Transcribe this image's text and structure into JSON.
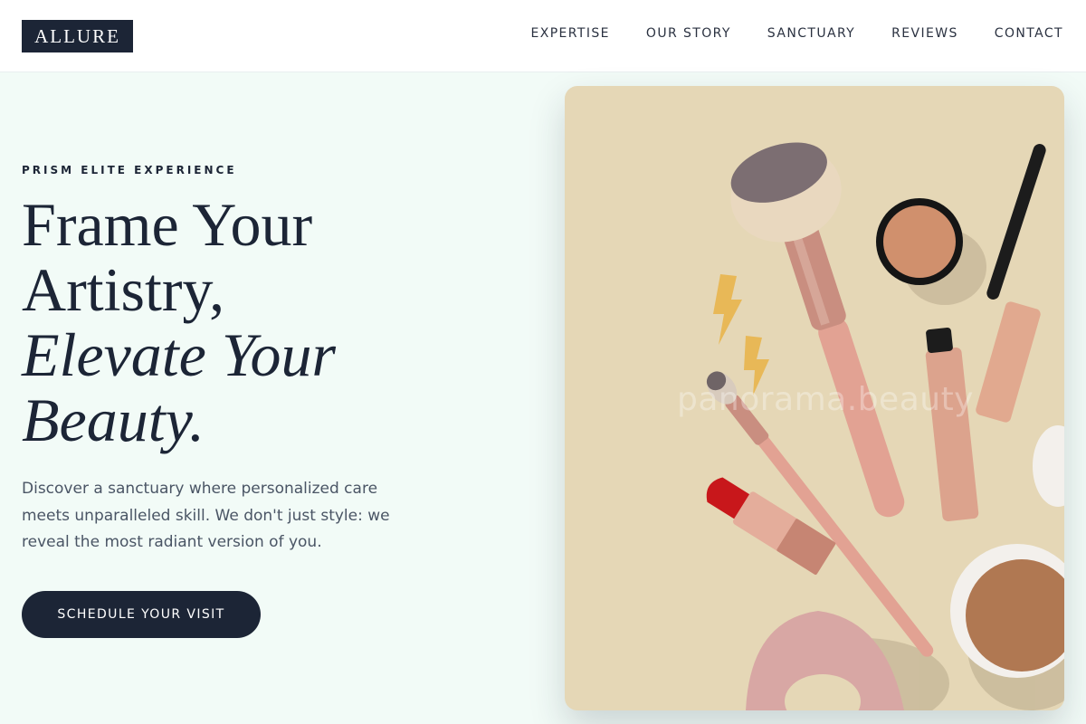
{
  "header": {
    "logo": "ALLURE",
    "nav": [
      "EXPERTISE",
      "OUR STORY",
      "SANCTUARY",
      "REVIEWS",
      "CONTACT"
    ]
  },
  "hero": {
    "eyebrow": "PRISM ELITE EXPERIENCE",
    "headline_line1": "Frame Your",
    "headline_line2": "Artistry,",
    "headline_line3": "Elevate Your",
    "headline_line4": "Beauty.",
    "description": "Discover a sanctuary where personalized care meets unparalleled skill. We don't just style: we reveal the most radiant version of you.",
    "cta": "SCHEDULE YOUR VISIT"
  },
  "image": {
    "watermark": "panorama.beauty"
  },
  "colors": {
    "brand_dark": "#1c2536",
    "hero_background": "#f2fbf7",
    "image_background": "#e5d7b6"
  }
}
